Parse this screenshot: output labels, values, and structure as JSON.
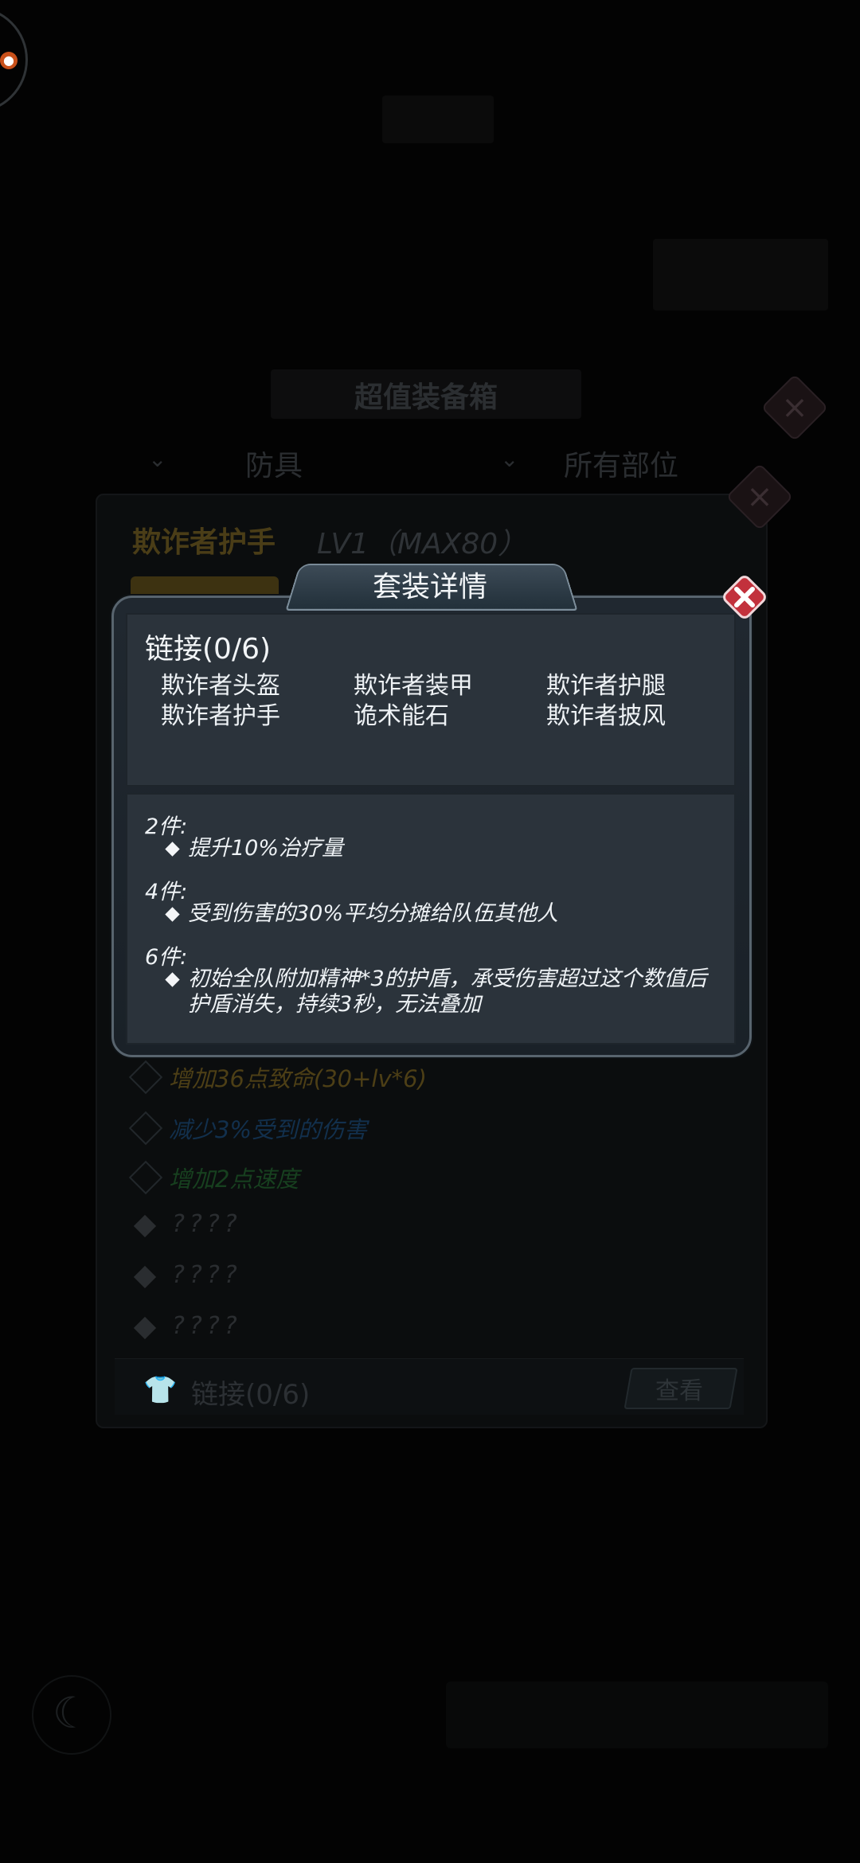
{
  "background": {
    "shop_title": "超值装备箱",
    "filter_type": "防具",
    "filter_part": "所有部位",
    "item_name": "欺诈者护手",
    "item_level": "LV1（MAX80）",
    "attributes": [
      {
        "text": "增加36点致命(30+lv*6)",
        "color": "#4d3f16"
      },
      {
        "text": "减少3%受到的伤害",
        "color": "#12304d"
      },
      {
        "text": "增加2点速度",
        "color": "#17401f"
      }
    ],
    "unknown_lines": [
      "????",
      "????",
      "????"
    ],
    "chain_label": "链接(0/6)",
    "view_button": "查看"
  },
  "modal": {
    "title": "套装详情",
    "close_icon": "close-x-icon",
    "chain_title": "链接(0/6)",
    "pieces": [
      "欺诈者头盔",
      "欺诈者装甲",
      "欺诈者护腿",
      "欺诈者护手",
      "诡术能石",
      "欺诈者披风"
    ],
    "bonuses": [
      {
        "tier": "2件:",
        "effect": "提升10%治疗量"
      },
      {
        "tier": "4件:",
        "effect": "受到伤害的30%平均分摊给队伍其他人"
      },
      {
        "tier": "6件:",
        "effect": "初始全队附加精神*3的护盾，承受伤害超过这个数值后护盾消失，持续3秒，无法叠加"
      }
    ]
  },
  "colors": {
    "accent_close": "#c0303a",
    "panel": "#2b333b",
    "text": "#eef2f5"
  }
}
